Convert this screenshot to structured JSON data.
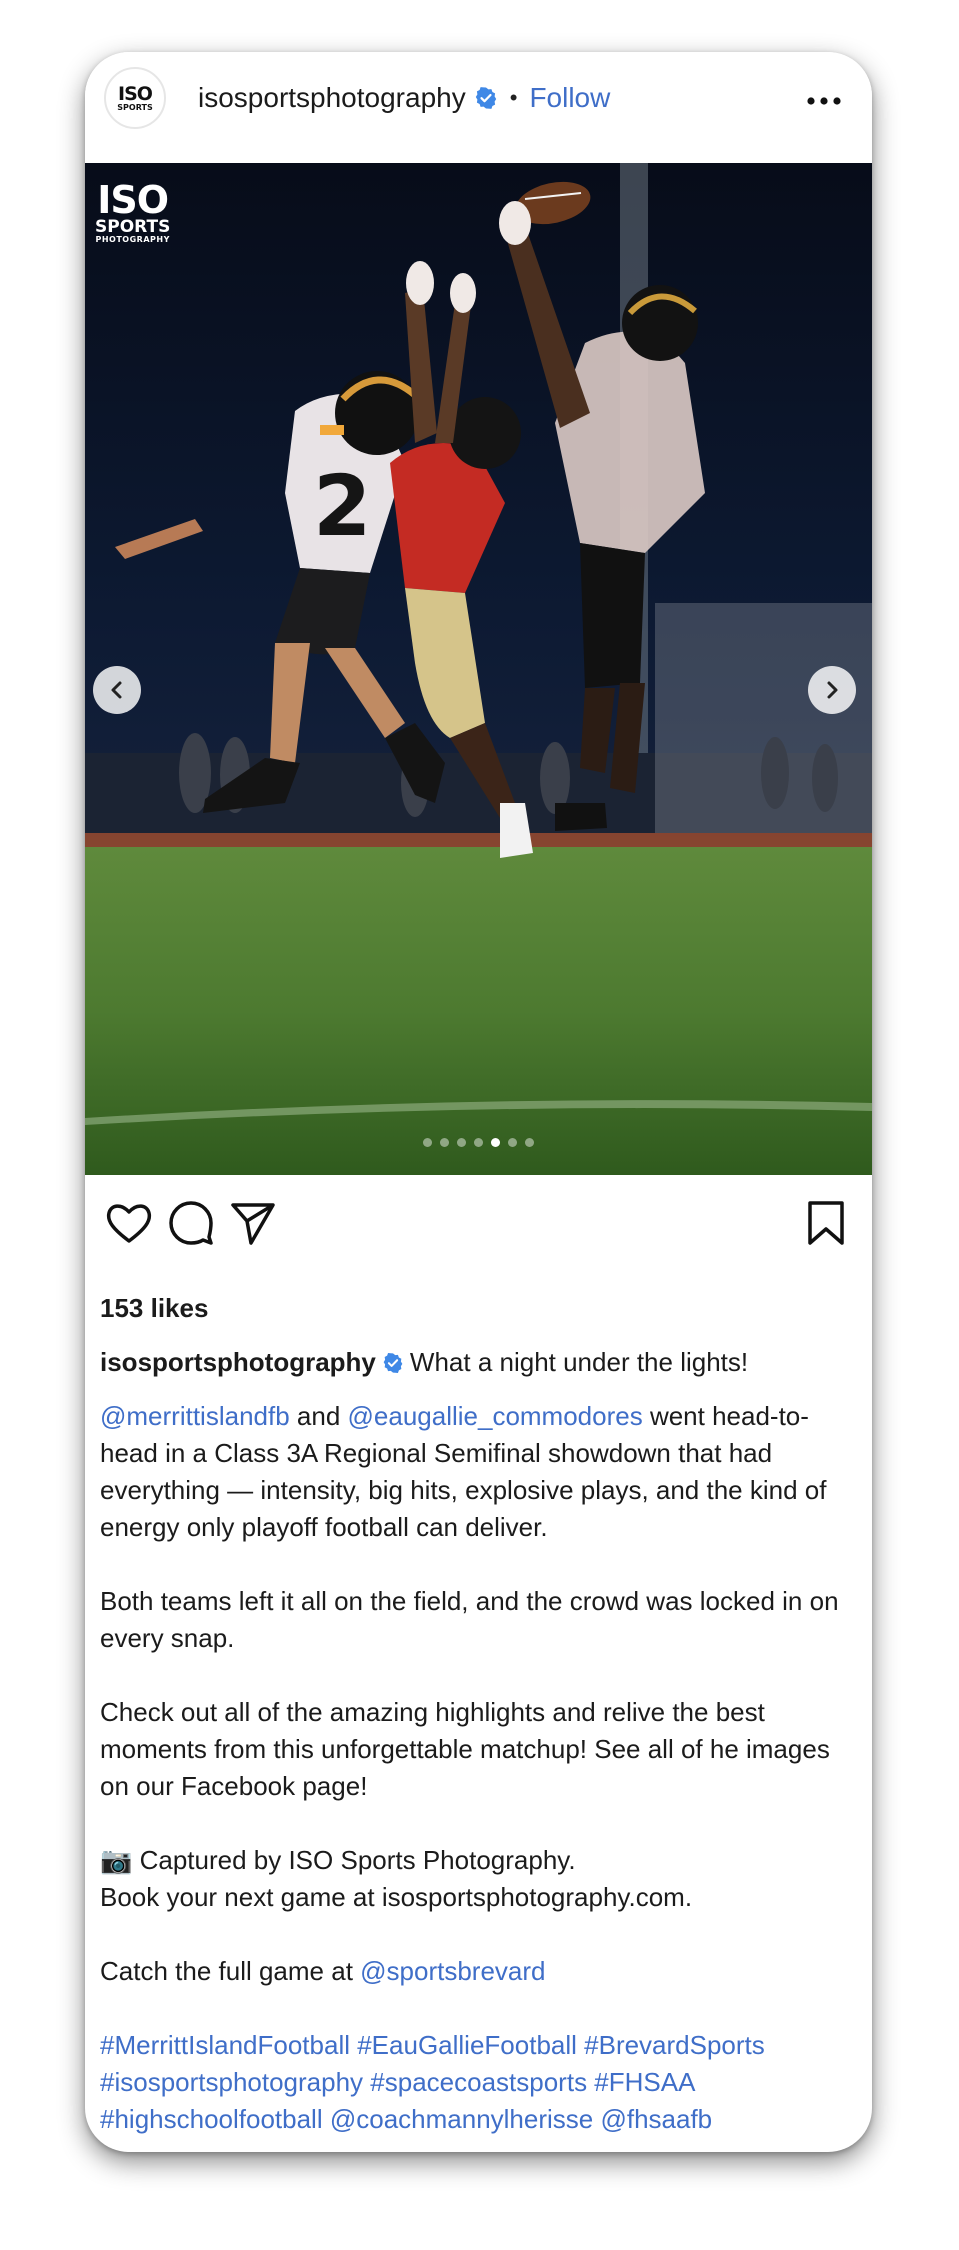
{
  "post": {
    "username": "isosportsphotography",
    "separator": "•",
    "follow_label": "Follow",
    "avatar_text_top": "ISO",
    "avatar_text_bottom": "SPORTS",
    "watermark_top": "ISO",
    "watermark_mid": "SPORTS",
    "watermark_bottom": "PHOTOGRAPHY",
    "carousel": {
      "count": 7,
      "active_index": 4
    },
    "likes": "153 likes",
    "caption_head": "What a night under the lights!",
    "colors": {
      "link": "#3f6ec8",
      "verified": "#3f88e6"
    }
  },
  "caption": {
    "mention_merritt": "@merrittislandfb",
    "and_word": " and ",
    "mention_eau": "@eaugallie_commodores",
    "p1_rest": " went head-to-head in a Class 3A Regional Semifinal showdown that had everything — intensity, big hits, explosive plays, and the kind of energy only playoff football can deliver.",
    "p2": "Both teams left it all on the field, and the crowd was locked in on every snap.",
    "p3": "Check out all of the amazing highlights and relive the best moments from this unforgettable matchup! See all of he images on our Facebook page!",
    "p4_line1": "📷 Captured by ISO Sports Photography.",
    "p4_line2": "Book your next game at isosportsphotography.com.",
    "p5_text": "Catch the full game at ",
    "p5_mention": "@sportsbrevard",
    "tags": "#MerrittIslandFootball #EauGallieFootball #BrevardSports #isosportsphotography #spacecoastsports #FHSAA #highschoolfootball @coachmannylherisse @fhsaafb"
  },
  "icons": {
    "more": "more-icon",
    "verified": "verified-badge-icon",
    "like": "heart-icon",
    "comment": "comment-icon",
    "share": "share-icon",
    "save": "bookmark-icon",
    "prev": "chevron-left-icon",
    "next": "chevron-right-icon"
  }
}
